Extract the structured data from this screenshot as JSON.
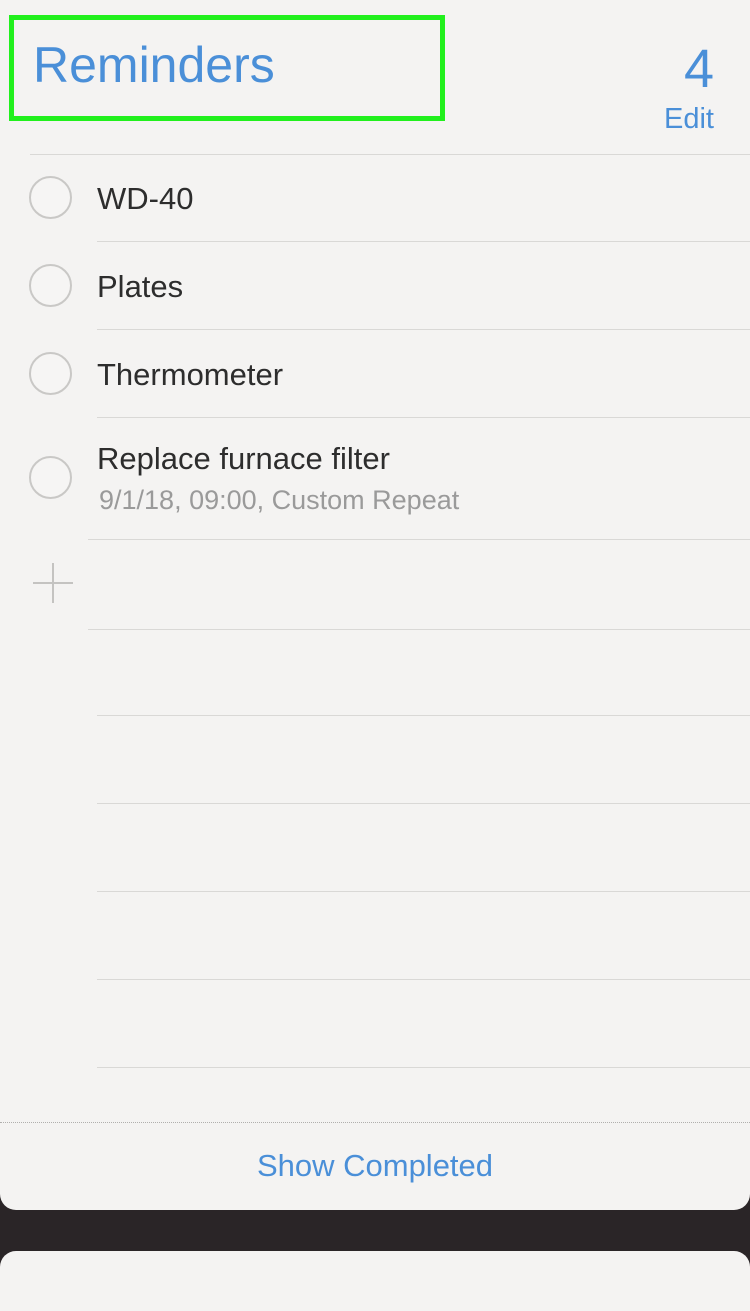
{
  "header": {
    "title": "Reminders",
    "count": "4",
    "edit_label": "Edit"
  },
  "reminders": [
    {
      "title": "WD-40"
    },
    {
      "title": "Plates"
    },
    {
      "title": "Thermometer"
    },
    {
      "title": "Replace furnace filter",
      "detail": "9/1/18, 09:00, Custom Repeat"
    }
  ],
  "footer": {
    "show_completed_label": "Show Completed"
  },
  "icons": {
    "add": "plus-icon"
  },
  "colors": {
    "accent": "#4a8fd8",
    "highlight": "#21f01d"
  }
}
